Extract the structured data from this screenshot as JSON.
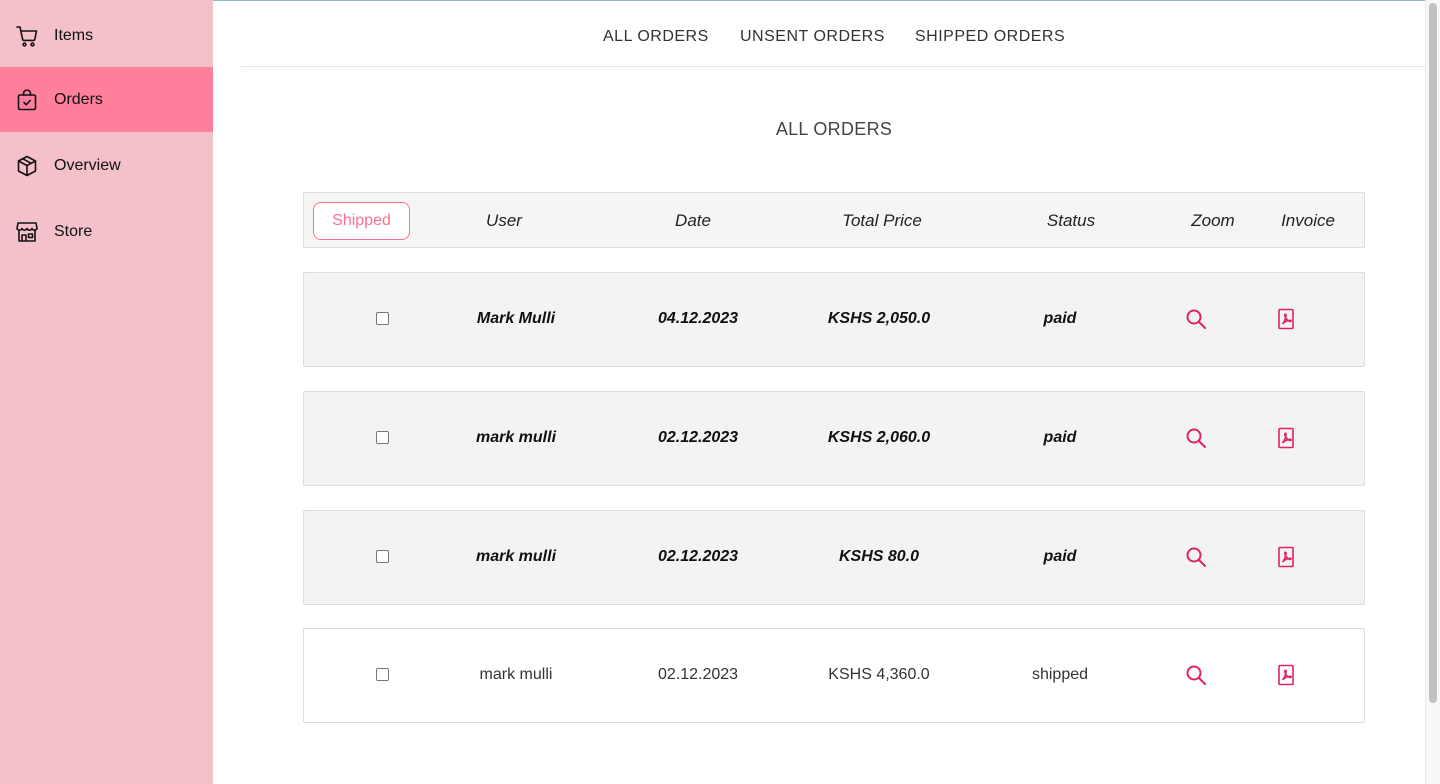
{
  "sidebar": {
    "items": [
      {
        "label": "Items",
        "icon": "cart-icon",
        "active": false
      },
      {
        "label": "Orders",
        "icon": "bag-check-icon",
        "active": true
      },
      {
        "label": "Overview",
        "icon": "box-icon",
        "active": false
      },
      {
        "label": "Store",
        "icon": "storefront-icon",
        "active": false
      }
    ]
  },
  "tabs": [
    "ALL ORDERS",
    "UNSENT ORDERS",
    "SHIPPED ORDERS"
  ],
  "page_title": "ALL ORDERS",
  "table": {
    "filter_button": "Shipped",
    "headers": {
      "user": "User",
      "date": "Date",
      "total": "Total Price",
      "status": "Status",
      "zoom": "Zoom",
      "invoice": "Invoice"
    },
    "rows": [
      {
        "user": "Mark Mulli",
        "date": "04.12.2023",
        "total": "KSHS 2,050.0",
        "status": "paid",
        "checked": false
      },
      {
        "user": "mark mulli",
        "date": "02.12.2023",
        "total": "KSHS 2,060.0",
        "status": "paid",
        "checked": false
      },
      {
        "user": "mark mulli",
        "date": "02.12.2023",
        "total": "KSHS 80.0",
        "status": "paid",
        "checked": false
      },
      {
        "user": "mark mulli",
        "date": "02.12.2023",
        "total": "KSHS 4,360.0",
        "status": "shipped",
        "checked": false
      }
    ]
  },
  "colors": {
    "sidebar_bg": "#f4c0ca",
    "sidebar_active": "#ff7f9c",
    "accent": "#ff6f91",
    "icon_red": "#e0245e"
  }
}
